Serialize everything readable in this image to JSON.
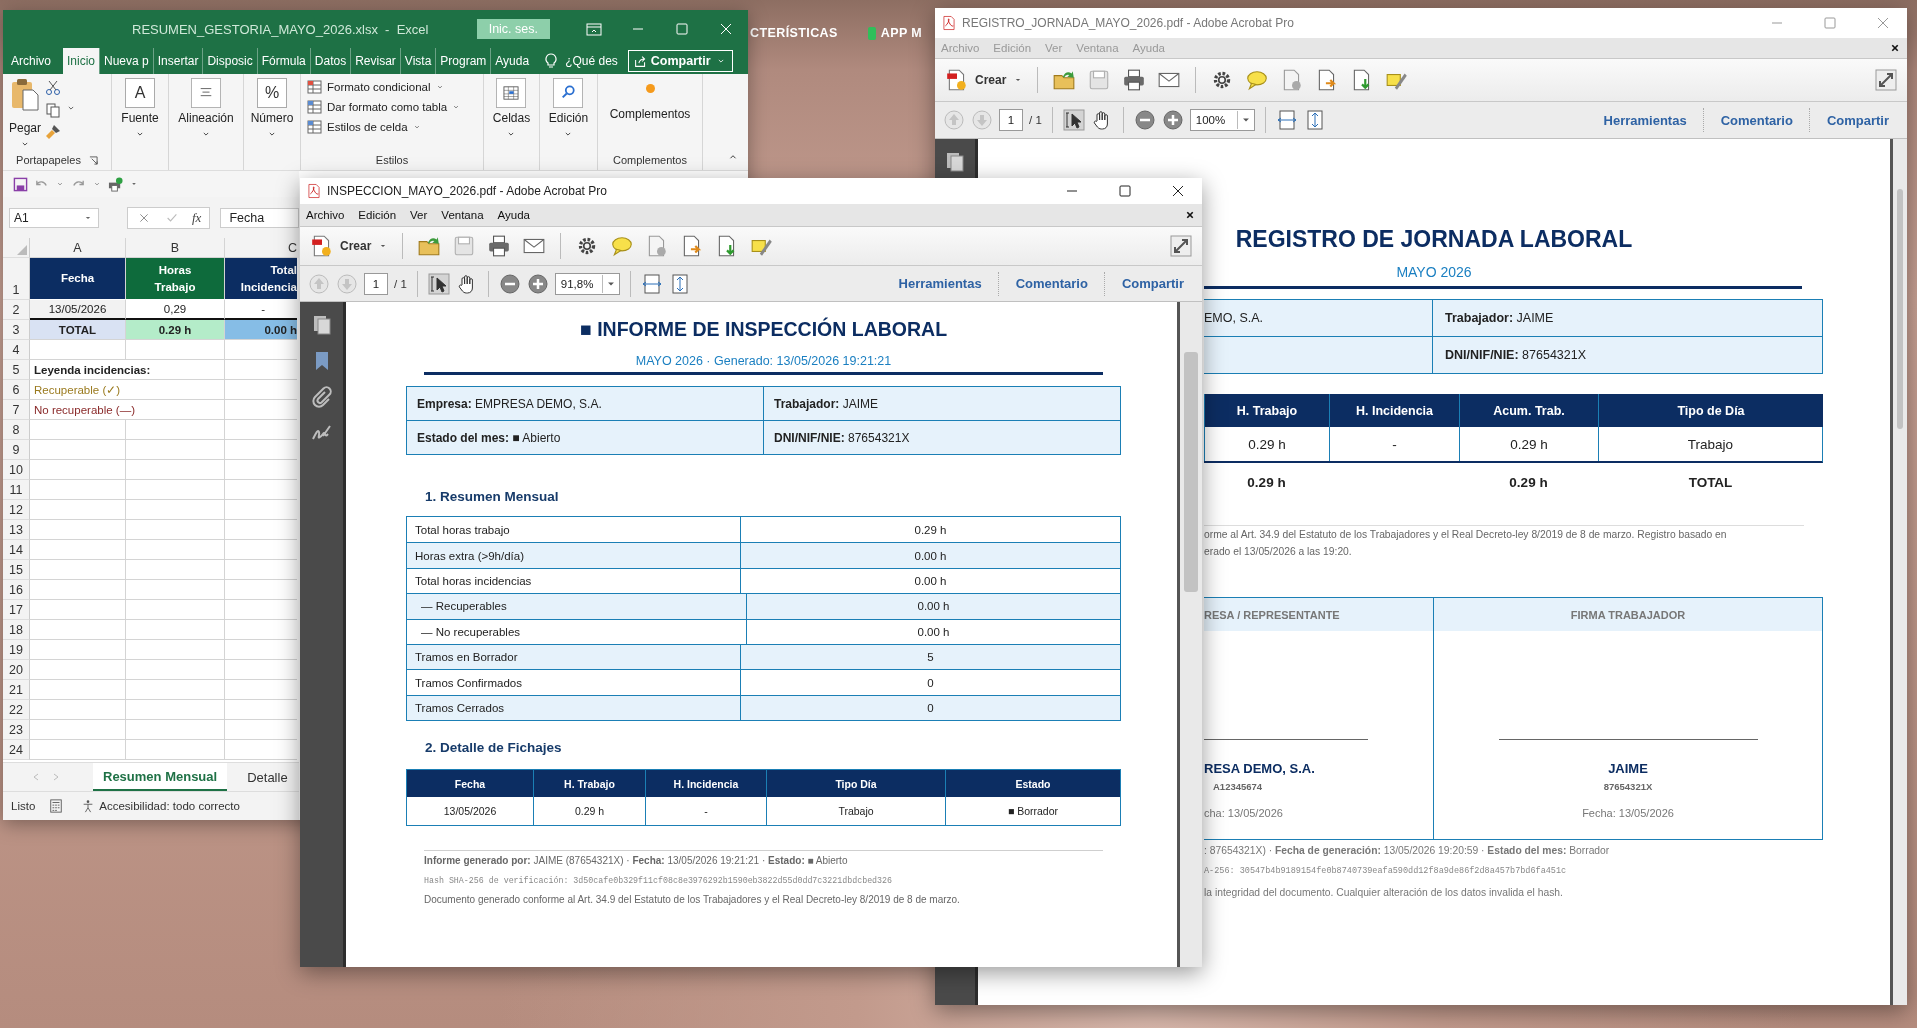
{
  "desktop": {
    "site_nav": [
      {
        "label": "CTERÍSTICAS",
        "kind": "text"
      },
      {
        "label": "APP M",
        "kind": "app"
      }
    ]
  },
  "excel": {
    "title": "RESUMEN_GESTORIA_MAYO_2026.xlsx  -  Excel",
    "sign_in": "Inic. ses.",
    "tabs": [
      {
        "label": "Archivo",
        "selected": false
      },
      {
        "label": "Inicio",
        "selected": true
      },
      {
        "label": "Nueva p",
        "selected": false
      },
      {
        "label": "Insertar",
        "selected": false
      },
      {
        "label": "Disposic",
        "selected": false
      },
      {
        "label": "Fórmula",
        "selected": false
      },
      {
        "label": "Datos",
        "selected": false
      },
      {
        "label": "Revisar",
        "selected": false
      },
      {
        "label": "Vista",
        "selected": false
      },
      {
        "label": "Program",
        "selected": false
      },
      {
        "label": "Ayuda",
        "selected": false
      }
    ],
    "tell_me": "¿Qué des",
    "share": "Compartir",
    "ribbon": [
      {
        "kind": "clipboard",
        "label": "Pegar",
        "group": "Portapapeles"
      },
      {
        "kind": "glyph",
        "label": "Fuente",
        "glyph": "A"
      },
      {
        "kind": "align",
        "label": "Alineación"
      },
      {
        "kind": "glyph",
        "label": "Número",
        "glyph": "%"
      },
      {
        "kind": "styles",
        "items": [
          "Formato condicional",
          "Dar formato como tabla",
          "Estilos de celda"
        ],
        "group": "Estilos"
      },
      {
        "kind": "cells",
        "label": "Celdas"
      },
      {
        "kind": "search",
        "label": "Edición"
      },
      {
        "kind": "addins",
        "label": "Complementos",
        "group": "Complementos"
      }
    ],
    "name_box": "A1",
    "function_label": "fx",
    "formula": "Fecha",
    "columns": [
      "A",
      "B",
      "C"
    ],
    "rows": [
      {
        "number": "1",
        "kind": "header",
        "cells": [
          "Fecha",
          "Horas Trabajo",
          "Total Incidencia"
        ]
      },
      {
        "number": "2",
        "kind": "data",
        "cells": [
          "13/05/2026",
          "0,29",
          "-"
        ]
      },
      {
        "number": "3",
        "kind": "total",
        "cells": [
          "TOTAL",
          "0.29 h",
          "0.00 h"
        ]
      },
      {
        "number": "4",
        "kind": "empty"
      },
      {
        "number": "5",
        "kind": "legend",
        "cells": [
          "Leyenda incidencias:"
        ]
      },
      {
        "number": "6",
        "kind": "ok",
        "cells": [
          "Recuperable (✓)"
        ]
      },
      {
        "number": "7",
        "kind": "bad",
        "cells": [
          "No recuperable (—)"
        ]
      },
      {
        "number": "8",
        "kind": "empty"
      },
      {
        "number": "9",
        "kind": "empty"
      },
      {
        "number": "10",
        "kind": "empty"
      },
      {
        "number": "11",
        "kind": "empty"
      },
      {
        "number": "12",
        "kind": "empty"
      },
      {
        "number": "13",
        "kind": "empty"
      },
      {
        "number": "14",
        "kind": "empty"
      },
      {
        "number": "15",
        "kind": "empty"
      },
      {
        "number": "16",
        "kind": "empty"
      },
      {
        "number": "17",
        "kind": "empty"
      },
      {
        "number": "18",
        "kind": "empty"
      },
      {
        "number": "19",
        "kind": "empty"
      },
      {
        "number": "20",
        "kind": "empty"
      },
      {
        "number": "21",
        "kind": "empty"
      },
      {
        "number": "22",
        "kind": "empty"
      },
      {
        "number": "23",
        "kind": "empty"
      },
      {
        "number": "24",
        "kind": "empty"
      }
    ],
    "sheets": [
      {
        "label": "Resumen Mensual",
        "selected": true
      },
      {
        "label": "Detalle",
        "selected": false
      }
    ],
    "status": "Listo",
    "accessibility": "Accesibilidad: todo correcto"
  },
  "back_pdf": {
    "title": "REGISTRO_JORNADA_MAYO_2026.pdf - Adobe Acrobat Pro",
    "active": false,
    "menu": [
      "Archivo",
      "Edición",
      "Ver",
      "Ventana",
      "Ayuda"
    ],
    "create": "Crear",
    "page": "1",
    "pages": "/ 1",
    "zoom": "100%",
    "links": [
      "Herramientas",
      "Comentario",
      "Compartir"
    ],
    "doc": {
      "title": "REGISTRO DE JORNADA LABORAL",
      "subtitle": "MAYO 2026",
      "info": [
        {
          "left": "EMO, S.A.",
          "right": "**Trabajador:** JAIME"
        },
        {
          "right": "**DNI/NIF/NIE:** 87654321X"
        }
      ],
      "columns": [
        "H. Trabajo",
        "H. Incidencia",
        "Acum. Trab.",
        "Tipo de Día"
      ],
      "rows": [
        [
          "0.29 h",
          "-",
          "0.29 h",
          "Trabajo"
        ]
      ],
      "total_work": "0.29 h",
      "total_accum": "0.29 h",
      "total_label": "TOTAL",
      "legal": [
        "orme al Art. 34.9 del Estatuto de los Trabajadores y el Real Decreto-ley 8/2019 de 8 de marzo. Registro basado en",
        "erado el 13/05/2026 a las 19:20."
      ],
      "signatures": [
        {
          "heading": "RESA / REPRESENTANTE",
          "name": "RESA DEMO, S.A.",
          "id": "A12345674",
          "date": "cha: 13/05/2026"
        },
        {
          "heading": "FIRMA TRABAJADOR",
          "name": "JAIME",
          "id": "87654321X",
          "date": "Fecha: 13/05/2026"
        }
      ],
      "footer": [
        ": 87654321X) · **Fecha de generación:** 13/05/2026 19:20:59 · **Estado del mes:** Borrador",
        "A-256: 30547b4b9189154fe0b8740739eafa590dd12f8a9de86f2d8a457b7bd6fa451c",
        "la integridad del documento. Cualquier alteración de los datos invalida el hash."
      ]
    }
  },
  "front_pdf": {
    "title": "INSPECCION_MAYO_2026.pdf - Adobe Acrobat Pro",
    "active": true,
    "menu": [
      "Archivo",
      "Edición",
      "Ver",
      "Ventana",
      "Ayuda"
    ],
    "create": "Crear",
    "page": "1",
    "pages": "/ 1",
    "zoom": "91,8%",
    "links": [
      "Herramientas",
      "Comentario",
      "Compartir"
    ],
    "doc": {
      "title": "■ INFORME DE INSPECCIÓN LABORAL",
      "subtitle": "MAYO 2026 · Generado: 13/05/2026 19:21:21",
      "info": [
        [
          "**Empresa:** EMPRESA DEMO, S.A.",
          "**Trabajador:** JAIME"
        ],
        [
          "**Estado del mes:** ■ Abierto",
          "**DNI/NIF/NIE:** 87654321X"
        ]
      ],
      "section1": "1. Resumen Mensual",
      "summary": [
        {
          "label": "Total horas trabajo",
          "value": "0.29 h"
        },
        {
          "label": "Horas extra (>9h/día)",
          "value": "0.00 h"
        },
        {
          "label": "Total horas incidencias",
          "value": "0.00 h",
          "children": [
            {
              "label": "— Recuperables",
              "value": "0.00 h"
            },
            {
              "label": "— No recuperables",
              "value": "0.00 h"
            }
          ]
        },
        {
          "label": "Tramos en Borrador",
          "value": "5"
        },
        {
          "label": "Tramos Confirmados",
          "value": "0"
        },
        {
          "label": "Tramos Cerrados",
          "value": "0"
        }
      ],
      "section2": "2. Detalle de Fichajes",
      "columns": [
        "Fecha",
        "H. Trabajo",
        "H. Incidencia",
        "Tipo Día",
        "Estado"
      ],
      "rows": [
        [
          "13/05/2026",
          "0.29 h",
          "-",
          "Trabajo",
          "■ Borrador"
        ]
      ],
      "footer": [
        "**Informe generado por:** JAIME (87654321X) · **Fecha:** 13/05/2026 19:21:21 · **Estado:** ■ Abierto",
        "Hash SHA-256 de verificación: 3d50cafe0b329f11cf08c8e3976292b1590eb3822d55d0dd7c3221dbdcbed326",
        "Documento generado conforme al Art. 34.9 del Estatuto de los Trabajadores y el Real Decreto-ley 8/2019 de 8 de marzo."
      ]
    }
  }
}
